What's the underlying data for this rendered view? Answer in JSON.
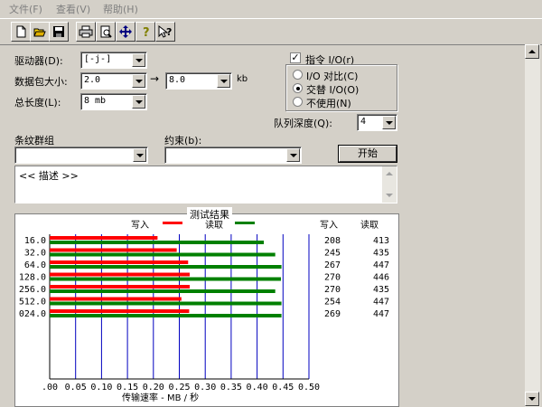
{
  "menu": {
    "items": [
      "文件(F)",
      "查看(V)",
      "帮助(H)"
    ]
  },
  "form": {
    "drive_label": "驱动器(D):",
    "drive_value": "[-j-]",
    "packet_label": "数据包大小:",
    "packet_from": "2.0",
    "packet_to": "8.0",
    "packet_unit": "kb",
    "total_label": "总长度(L):",
    "total_value": "8 mb",
    "stripe_label": "条纹群组",
    "stripe_value": "",
    "constraint_label": "约束(b):",
    "constraint_value": "",
    "description": "<< 描述 >>",
    "start_button": "开始"
  },
  "io": {
    "direct_io_label": "指令 I/O(r)",
    "direct_io_checked": true,
    "options": [
      {
        "label": "I/O 对比(C)",
        "selected": false
      },
      {
        "label": "交替 I/O(O)",
        "selected": true
      },
      {
        "label": "不使用(N)",
        "selected": false
      }
    ],
    "queue_label": "队列深度(Q):",
    "queue_value": "4"
  },
  "results": {
    "title": "测试结果",
    "legend_write": "写入",
    "legend_read": "读取",
    "col_write": "写入",
    "col_read": "读取",
    "xlabel": "传输速率 - MB / 秒"
  },
  "chart_data": {
    "type": "bar",
    "orientation": "horizontal",
    "title": "测试结果",
    "xlabel": "传输速率 - MB / 秒",
    "xlim": [
      0,
      0.5
    ],
    "x_ticks": [
      ".00",
      "0.05",
      "0.10",
      "0.15",
      "0.20",
      "0.25",
      "0.30",
      "0.35",
      "0.40",
      "0.45",
      "0.50"
    ],
    "categories": [
      "16.0",
      "32.0",
      "64.0",
      "128.0",
      "256.0",
      "512.0",
      "024.0"
    ],
    "series": [
      {
        "name": "写入",
        "color": "#ff0000",
        "values": [
          0.208,
          0.245,
          0.267,
          0.27,
          0.27,
          0.254,
          0.269
        ]
      },
      {
        "name": "读取",
        "color": "#008000",
        "values": [
          0.413,
          0.435,
          0.447,
          0.446,
          0.435,
          0.447,
          0.447
        ]
      }
    ],
    "table": {
      "write": [
        "208",
        "245",
        "267",
        "270",
        "270",
        "254",
        "269"
      ],
      "read": [
        "413",
        "435",
        "447",
        "446",
        "435",
        "447",
        "447"
      ]
    },
    "gridline_color": "#0000c0"
  }
}
